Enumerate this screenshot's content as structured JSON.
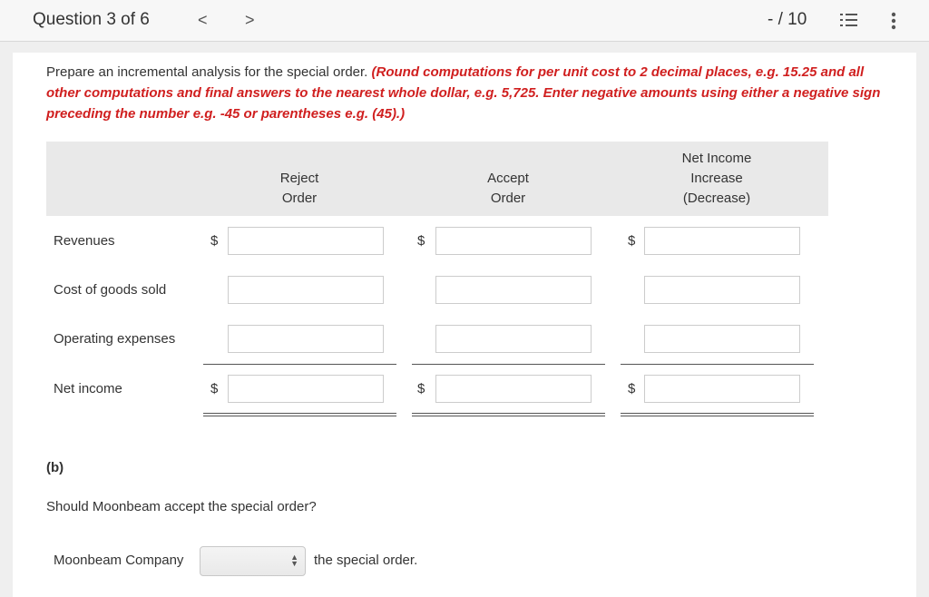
{
  "header": {
    "question": "Question 3 of 6",
    "prev": "<",
    "next": ">",
    "score": "- / 10",
    "list_icon": "numbered-list-icon",
    "more_icon": "more-vertical-icon"
  },
  "instructions": {
    "text": "Prepare an incremental analysis for the special order. ",
    "note": "(Round computations for per unit cost to 2 decimal places, e.g. 15.25 and all other computations and final answers to the nearest whole dollar, e.g. 5,725. Enter negative amounts using either a negative sign preceding the number e.g. -45 or parentheses e.g. (45).)"
  },
  "table": {
    "columns": [
      {
        "l1": "Reject",
        "l2": "Order"
      },
      {
        "l1": "Accept",
        "l2": "Order"
      },
      {
        "l1": "Net Income",
        "l2": "Increase",
        "l3": "(Decrease)"
      }
    ],
    "rows": [
      {
        "label": "Revenues",
        "currency": "$"
      },
      {
        "label": "Cost of goods sold",
        "currency": ""
      },
      {
        "label": "Operating expenses",
        "currency": ""
      },
      {
        "label": "Net income",
        "currency": "$"
      }
    ],
    "values": [
      [
        "",
        "",
        ""
      ],
      [
        "",
        "",
        ""
      ],
      [
        "",
        "",
        ""
      ],
      [
        "",
        "",
        ""
      ]
    ]
  },
  "part_b": {
    "label": "(b)",
    "question": "Should Moonbeam accept the special order?",
    "prefix": "Moonbeam Company",
    "select_value": "",
    "suffix": "the special order."
  }
}
